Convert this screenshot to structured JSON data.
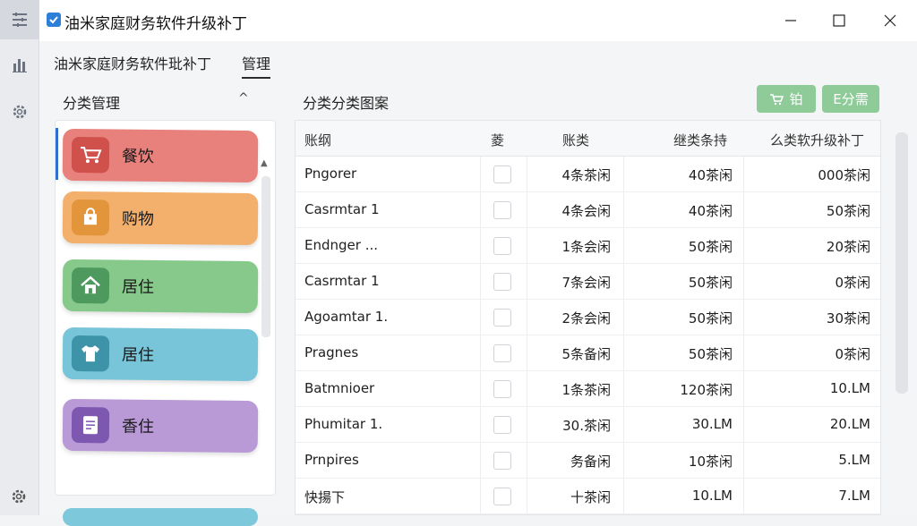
{
  "window": {
    "title": "油米家庭财务软件升级补丁"
  },
  "rail": {
    "items": [
      {
        "icon": "menu-list-icon",
        "active": true
      },
      {
        "icon": "bar-chart-icon",
        "active": false
      },
      {
        "icon": "gear-icon",
        "active": false
      }
    ],
    "bottom_icon": "settings-gear-icon"
  },
  "menu": {
    "tabs": [
      {
        "label": "油米家庭财务软件玭补丁",
        "active": false
      },
      {
        "label": "管理",
        "active": true
      }
    ]
  },
  "categories": {
    "header": "分类管理",
    "collapse_glyph": "^",
    "items": [
      {
        "label": "餐饮",
        "icon": "cart-icon",
        "color": "#e8807c",
        "icon_bg": "#d0504c"
      },
      {
        "label": "购物",
        "icon": "shopping-bag-icon",
        "color": "#f2b06c",
        "icon_bg": "#e3953c"
      },
      {
        "label": "居住",
        "icon": "home-icon",
        "color": "#86c98a",
        "icon_bg": "#4e9a5e"
      },
      {
        "label": "居住",
        "icon": "shirt-icon",
        "color": "#78c4d8",
        "icon_bg": "#3d94a8"
      },
      {
        "label": "香住",
        "icon": "document-icon",
        "color": "#b99ad6",
        "icon_bg": "#7d57b0"
      }
    ]
  },
  "main": {
    "section_title": "分类分类图案",
    "buttons": [
      {
        "label": "铂",
        "icon": "cart-icon"
      },
      {
        "label": "E分需"
      }
    ],
    "table": {
      "headers": [
        "账纲",
        "菱",
        "账类",
        "继类条持",
        "么类软升级补丁"
      ],
      "rows": [
        [
          "Pngorer",
          "4条茶闲",
          "40茶闲",
          "000茶闲"
        ],
        [
          "Casrmtar 1",
          "4条会闲",
          "40茶闲",
          "50茶闲"
        ],
        [
          "Endnger ...",
          "1条会闲",
          "50茶闲",
          "20茶闲"
        ],
        [
          "Casrmtar 1",
          "7条会闲",
          "50茶闲",
          "0茶闲"
        ],
        [
          "Agoamtar 1.",
          "2条会闲",
          "50茶闲",
          "30茶闲"
        ],
        [
          "Pragnes",
          "5条备闲",
          "50茶闲",
          "0茶闲"
        ],
        [
          "Batmnioer",
          "1条茶闲",
          "120茶闲",
          "10.LM"
        ],
        [
          "Phumitar 1.",
          "30.茶闲",
          "30.LM",
          "20.LM"
        ],
        [
          "Prnpires",
          "务备闲",
          "10茶闲",
          "5.LM"
        ],
        [
          "快揚下",
          "十茶闲",
          "10.LM",
          "7.LM"
        ]
      ]
    }
  },
  "colors": {
    "accent_green": "#8ecb98",
    "active_tab_bar": "#2f6fd0"
  }
}
